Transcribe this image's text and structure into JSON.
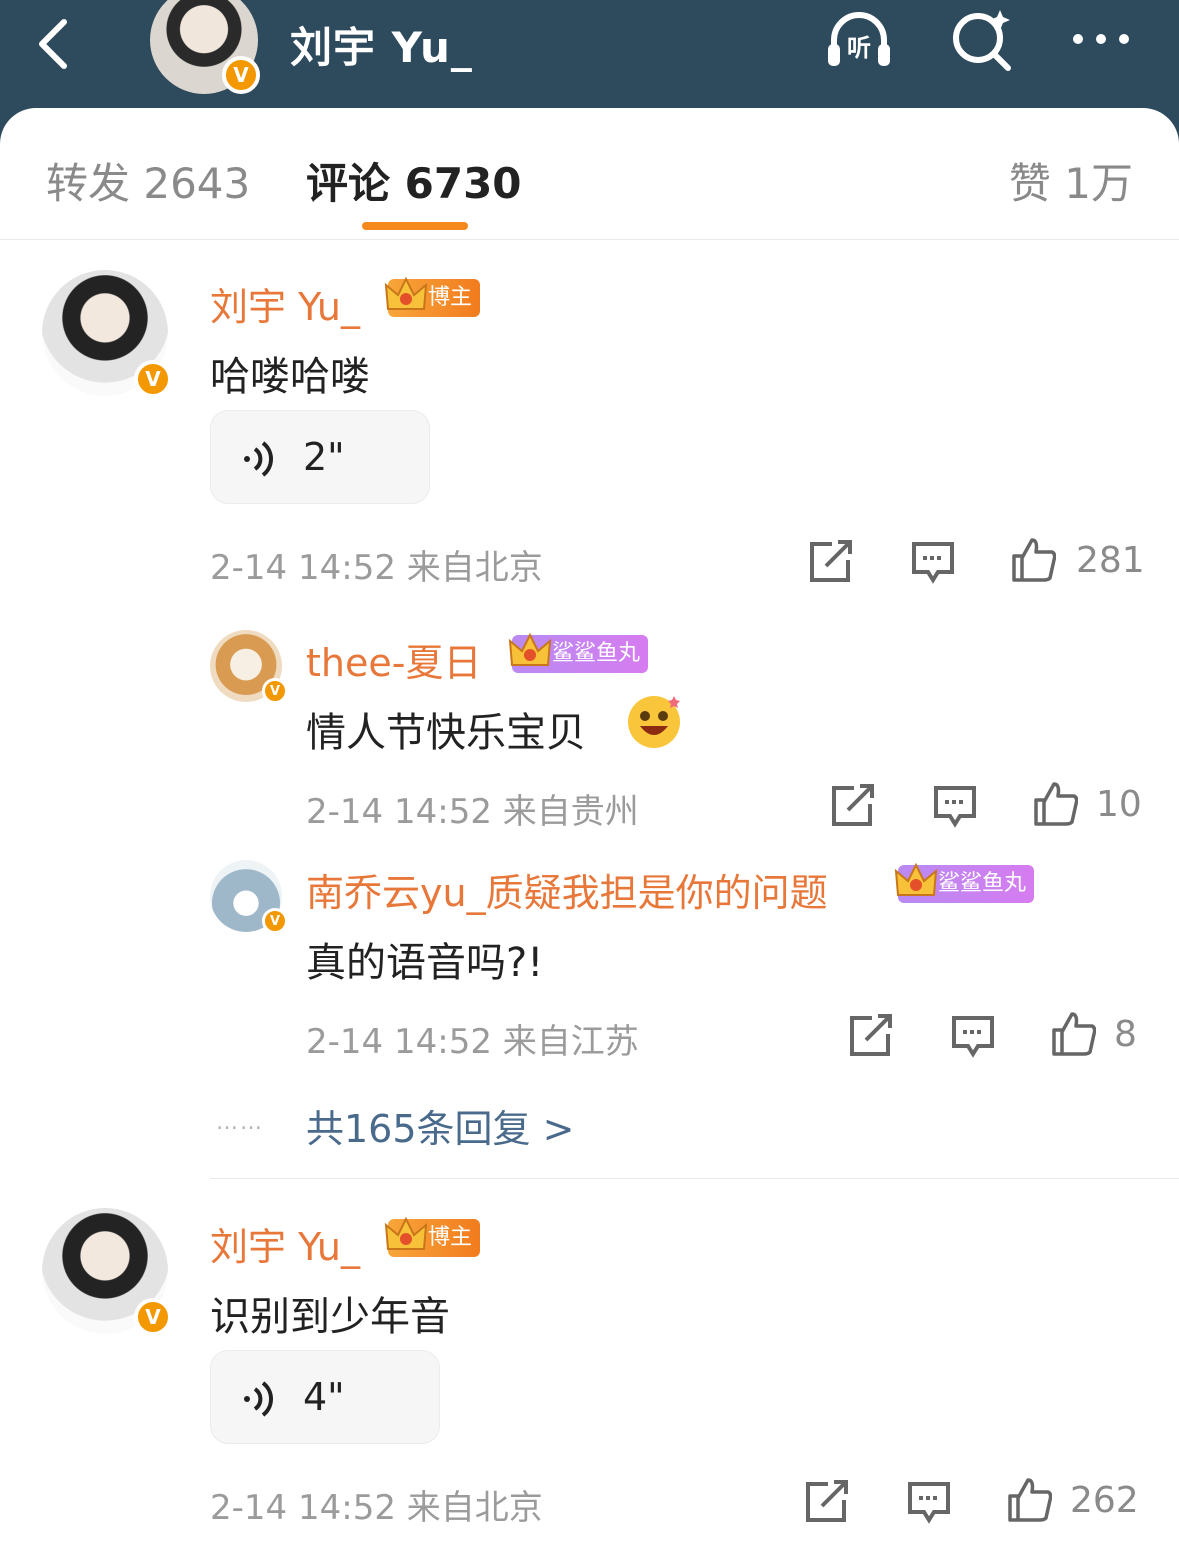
{
  "header": {
    "title": "刘宇 Yu_",
    "verified_mark": "V",
    "icons": [
      "back-arrow-icon",
      "listen-icon",
      "search-icon",
      "more-icon"
    ],
    "listen_label": "听",
    "colors": {
      "bar": "#2e4a5d",
      "accent": "#f5891d",
      "username": "#e8773a",
      "link": "#4a6a8c"
    }
  },
  "tabs": {
    "repost": "转发 2643",
    "comments": "评论 6730",
    "likes": "赞 1万"
  },
  "comments": [
    {
      "name": "刘宇 Yu_",
      "badge": "博主",
      "text": "哈喽哈喽",
      "voice": "2\"",
      "meta": "2-14 14:52  来自北京",
      "likes": "281"
    },
    {
      "name": "thee-夏日",
      "badge": "鲨鲨鱼丸",
      "text": "情人节快乐宝贝",
      "meta": "2-14 14:52  来自贵州",
      "likes": "10"
    },
    {
      "name": "南乔云yu_质疑我担是你的问题",
      "badge": "鲨鲨鱼丸",
      "text": "真的语音吗?!",
      "meta": "2-14 14:52  来自江苏",
      "likes": "8"
    },
    {
      "name": "刘宇 Yu_",
      "badge": "博主",
      "text": "识别到少年音",
      "voice": "4\"",
      "meta": "2-14 14:52  来自北京",
      "likes": "262"
    }
  ],
  "more_replies": "共165条回复 >",
  "dots": "……"
}
